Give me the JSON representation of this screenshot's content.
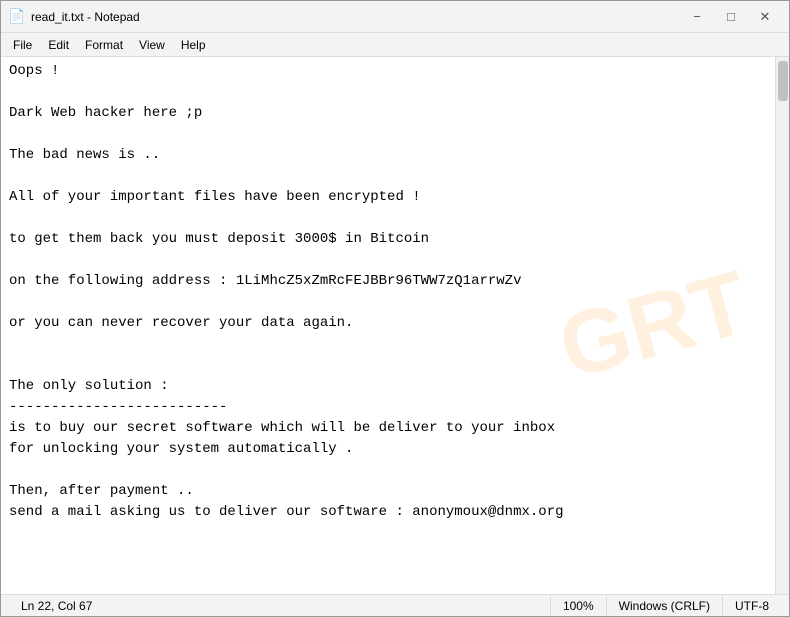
{
  "titlebar": {
    "title": "read_it.txt - Notepad",
    "minimize_label": "−",
    "maximize_label": "□",
    "close_label": "✕"
  },
  "menubar": {
    "items": [
      {
        "id": "file",
        "label": "File"
      },
      {
        "id": "edit",
        "label": "Edit"
      },
      {
        "id": "format",
        "label": "Format"
      },
      {
        "id": "view",
        "label": "View"
      },
      {
        "id": "help",
        "label": "Help"
      }
    ]
  },
  "editor": {
    "content": "Oops !\n\nDark Web hacker here ;p\n\nThe bad news is ..\n\nAll of your important files have been encrypted !\n\nto get them back you must deposit 3000$ in Bitcoin\n\non the following address : 1LiMhcZ5xZmRcFEJBBr96TWW7zQ1arrwZv\n\nor you can never recover your data again.\n\n\nThe only solution :\n--------------------------\nis to buy our secret software which will be deliver to your inbox\nfor unlocking your system automatically .\n\nThen, after payment ..\nsend a mail asking us to deliver our software : anonymoux@dnmx.org"
  },
  "statusbar": {
    "position": "Ln 22, Col 67",
    "zoom": "100%",
    "line_ending": "Windows (CRLF)",
    "encoding": "UTF-8"
  },
  "watermark": {
    "text": "GRT"
  }
}
